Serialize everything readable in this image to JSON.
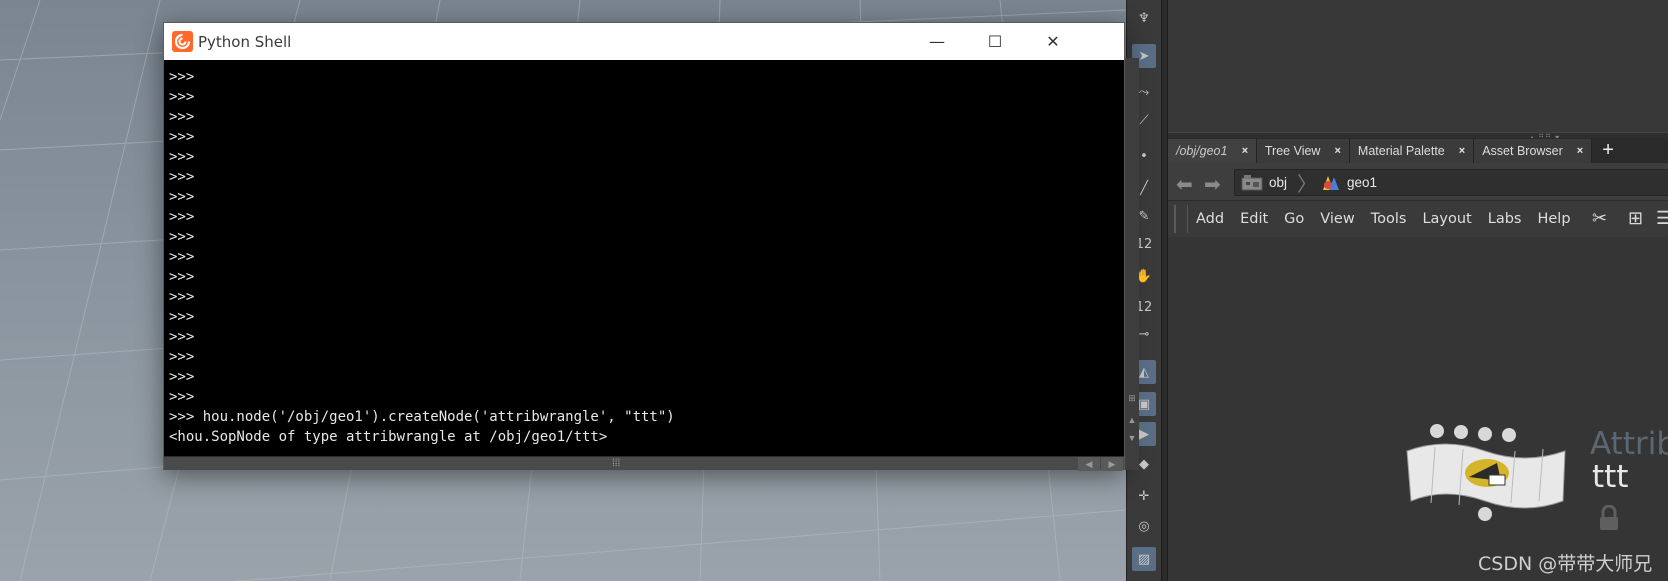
{
  "python_shell": {
    "title": "Python Shell",
    "window_controls": {
      "minimize": "—",
      "maximize": "☐",
      "close": "✕"
    },
    "prompt": ">>>",
    "lines": [
      ">>>",
      ">>>",
      ">>>",
      ">>>",
      ">>>",
      ">>>",
      ">>>",
      ">>>",
      ">>>",
      ">>>",
      ">>>",
      ">>>",
      ">>>",
      ">>>",
      ">>>",
      ">>>",
      ">>>",
      ">>>",
      ">>> hou.node('/obj/geo1').createNode('attribwrangle', \"ttt\")",
      "<hou.SopNode of type attribwrangle at /obj/geo1/ttt>",
      ">>>"
    ]
  },
  "shelf": {
    "labels": [
      "12",
      "12"
    ]
  },
  "network_pane": {
    "tabs": [
      {
        "label": "/obj/geo1",
        "active": true
      },
      {
        "label": "Tree View",
        "active": false
      },
      {
        "label": "Material Palette",
        "active": false
      },
      {
        "label": "Asset Browser",
        "active": false
      }
    ],
    "tab_close": "×",
    "tab_add": "+",
    "path": [
      {
        "label": "obj",
        "icon": "obj-context-icon"
      },
      {
        "label": "geo1",
        "icon": "geometry-icon"
      }
    ],
    "menu": [
      "Add",
      "Edit",
      "Go",
      "View",
      "Tools",
      "Layout",
      "Labs",
      "Help"
    ],
    "node": {
      "type_label": "Attrib",
      "name": "ttt"
    },
    "watermark": "CSDN @带带大师兄"
  },
  "colors": {
    "node_type_label": "#5b6773",
    "houdini_logo": "#ff6a2b",
    "selected_shelf": "#5a6f86"
  }
}
